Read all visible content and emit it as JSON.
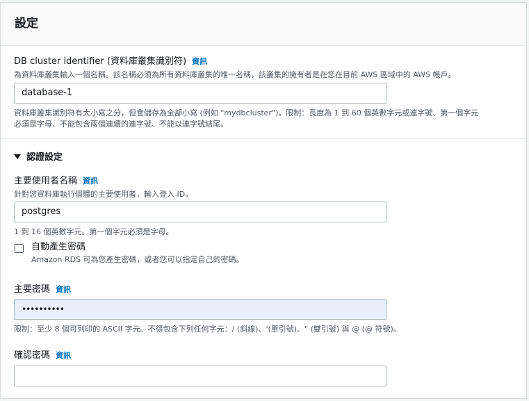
{
  "panel": {
    "title": "設定"
  },
  "cluster_identifier": {
    "label": "DB cluster identifier (資料庫叢集識別符)",
    "info": "資訊",
    "description": "為資料庫叢集輸入一個名稱。該名稱必須為所有資料庫叢集的唯一名稱，該叢集的擁有者是在您在目前 AWS 區域中的 AWS 帳戶。",
    "value": "database-1",
    "constraint_line1": "資料庫叢集識別符有大小寫之分，但會儲存為全部小寫 (例如 \"mydbcluster\")。限制：長度為 1 到 60 個英數字元或連字號、第一個字元",
    "constraint_line2": "必須是字母、不能包含兩個連續的連字號、不能以連字號結尾。"
  },
  "credentials": {
    "section_label": "認證設定",
    "master_username": {
      "label": "主要使用者名稱",
      "info": "資訊",
      "description": "針對您資料庫執行個體的主要使用者，輸入登入 ID。",
      "value": "postgres",
      "constraint": "1 到 16 個英數字元。第一個字元必須是字母。"
    },
    "auto_password": {
      "label": "自動產生密碼",
      "description": "Amazon RDS 可為您產生密碼，或者您可以指定自己的密碼。",
      "checked": false
    },
    "master_password": {
      "label": "主要密碼",
      "info": "資訊",
      "value": "••••••••••",
      "constraint": "限制：至少 8 個可列印的 ASCII 字元。不得包含下列任何字元：/ (斜線)、'(單引號)、\" (雙引號) 與 @ (@ 符號)。"
    },
    "confirm_password": {
      "label": "確認密碼",
      "info": "資訊",
      "value": ""
    }
  },
  "colors": {
    "link": "#0073bb",
    "border": "#aab7b8",
    "active_input_bg": "#e8f0fe"
  }
}
